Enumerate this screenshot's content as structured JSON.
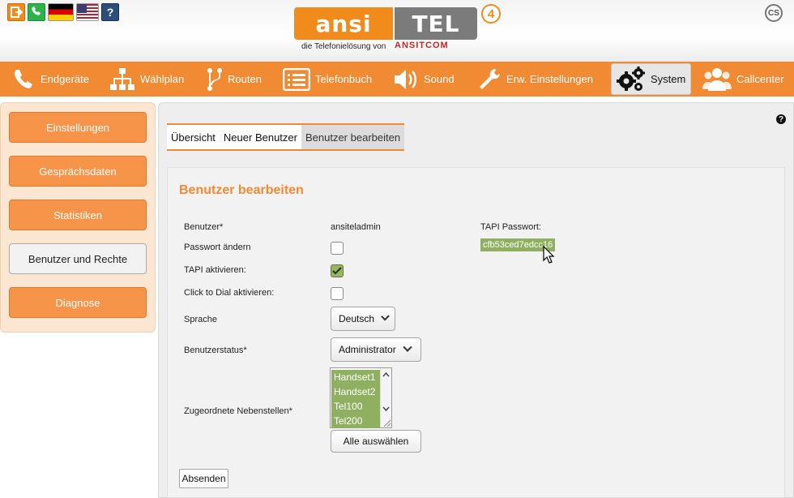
{
  "header": {
    "logo_left": "ansi",
    "logo_right": "TEL",
    "logo_version": "4",
    "tagline": "die Telefonielösung von",
    "tagline_brand": "ANSITCOM",
    "cs_badge": "CS",
    "help_glyph": "?"
  },
  "nav": {
    "items": [
      {
        "label": "Endgeräte",
        "icon": "phone-icon"
      },
      {
        "label": "Wählplan",
        "icon": "sitemap-icon"
      },
      {
        "label": "Routen",
        "icon": "route-icon"
      },
      {
        "label": "Telefonbuch",
        "icon": "phonebook-icon"
      },
      {
        "label": "Sound",
        "icon": "speaker-icon"
      },
      {
        "label": "Erw. Einstellungen",
        "icon": "wrench-icon"
      },
      {
        "label": "System",
        "icon": "gears-icon",
        "active": true
      },
      {
        "label": "Callcenter",
        "icon": "users-icon"
      }
    ]
  },
  "sidebar": {
    "items": [
      {
        "label": "Einstellungen"
      },
      {
        "label": "Gesprächsdaten"
      },
      {
        "label": "Statistiken"
      },
      {
        "label": "Benutzer und Rechte",
        "active": true
      },
      {
        "label": "Diagnose"
      }
    ]
  },
  "tabs": [
    {
      "label": "Übersicht"
    },
    {
      "label": "Neuer Benutzer"
    },
    {
      "label": "Benutzer bearbeiten",
      "active": true
    }
  ],
  "form": {
    "title": "Benutzer bearbeiten",
    "help_glyph": "?",
    "user_label": "Benutzer*",
    "user_value": "ansiteladmin",
    "password_change_label": "Passwort ändern",
    "password_change_checked": false,
    "tapi_label": "TAPI aktivieren:",
    "tapi_checked": true,
    "ctd_label": "Click to Dial aktivieren:",
    "ctd_checked": false,
    "language_label": "Sprache",
    "language_value": "Deutsch",
    "status_label": "Benutzerstatus*",
    "status_value": "Administrator",
    "extensions_label": "Zugeordnete Nebenstellen*",
    "extensions": [
      "Handset1",
      "Handset2",
      "Tel100",
      "Tel200"
    ],
    "select_all_label": "Alle auswählen",
    "tapi_password_label": "TAPI Passwort:",
    "tapi_password_value": "cfb53ced7edcc16",
    "submit_label": "Absenden"
  },
  "colors": {
    "brand_orange": "#f08b33",
    "selection_green": "#8fb061"
  }
}
